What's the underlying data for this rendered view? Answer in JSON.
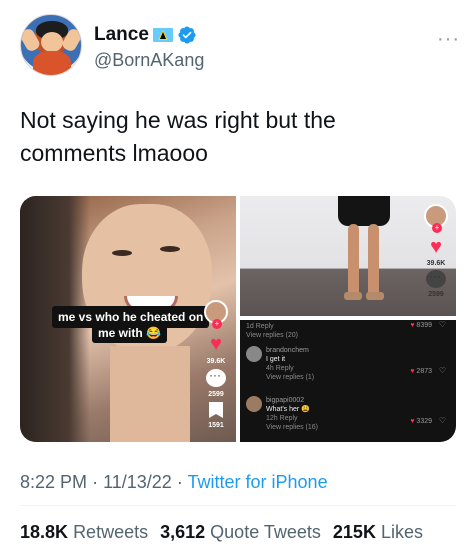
{
  "author": {
    "display_name": "Lance",
    "handle": "@BornAKang",
    "flag_icon": "saint-lucia-flag-icon",
    "verified_icon": "verified-badge-icon",
    "verified_color": "#1d9bf0"
  },
  "more_icon": "more-options-icon",
  "tweet": {
    "text": "Not saying he was right but the comments lmaooo"
  },
  "media": {
    "left_panel": {
      "caption_line1": "me vs who he cheated on",
      "caption_line2": "me with 😂",
      "likes": "39.6K",
      "comments": "2599",
      "saves": "1591"
    },
    "top_right_panel": {
      "likes": "39.6K",
      "comments": "2599"
    },
    "comments_panel": {
      "items": [
        {
          "user": "",
          "text": "",
          "time": "1d",
          "reply": "Reply",
          "view": "View replies (20)",
          "likes": "8399"
        },
        {
          "user": "brandonchem",
          "text": "I get it",
          "time": "4h",
          "reply": "Reply",
          "view": "View replies (1)",
          "likes": "2873"
        },
        {
          "user": "bigpapi0002",
          "text": "What's her 😩",
          "time": "12h",
          "reply": "Reply",
          "view": "View replies (16)",
          "likes": "3329"
        }
      ]
    }
  },
  "meta": {
    "time": "8:22 PM",
    "date": "11/13/22",
    "separator": "·",
    "source": "Twitter for iPhone"
  },
  "stats": {
    "retweets_count": "18.8K",
    "retweets_label": "Retweets",
    "quotes_count": "3,612",
    "quotes_label": "Quote Tweets",
    "likes_count": "215K",
    "likes_label": "Likes"
  },
  "colors": {
    "text": "#0f1419",
    "secondary": "#536471",
    "link": "#1d9bf0",
    "tiktok_red": "#fe2c55"
  }
}
